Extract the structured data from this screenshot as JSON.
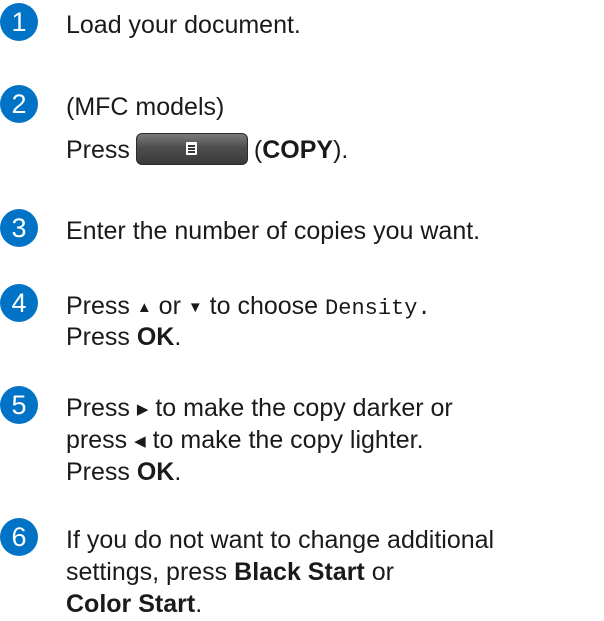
{
  "colors": {
    "step_badge": "#0073c6",
    "text": "#1a1a1a",
    "copy_button": "#4e4e4e"
  },
  "steps": [
    {
      "number": "1",
      "lines": [
        "Load your document."
      ]
    },
    {
      "number": "2",
      "line1": "(MFC models)",
      "press": "Press",
      "copy_icon": "copy-icon",
      "paren_open": "(",
      "copy_label": "COPY",
      "paren_close": ")."
    },
    {
      "number": "3",
      "text": "Enter the number of copies you want."
    },
    {
      "number": "4",
      "press": "Press",
      "up": "▲",
      "or": "or",
      "down": "▼",
      "choose": "to choose",
      "menu_item": "Density",
      "period": ".",
      "press2": "Press",
      "ok": "OK",
      "dot": "."
    },
    {
      "number": "5",
      "press": "Press",
      "right": "▶",
      "line1_rest": "to make the copy darker or",
      "press_lower": "press",
      "left": "◀",
      "line2_rest": "to make the copy lighter.",
      "press3": "Press",
      "ok": "OK",
      "dot": "."
    },
    {
      "number": "6",
      "line1": "If you do not want to change additional",
      "line2a": "settings, press",
      "black_start": "Black Start",
      "or": "or",
      "color_start": "Color Start",
      "dot": "."
    }
  ]
}
